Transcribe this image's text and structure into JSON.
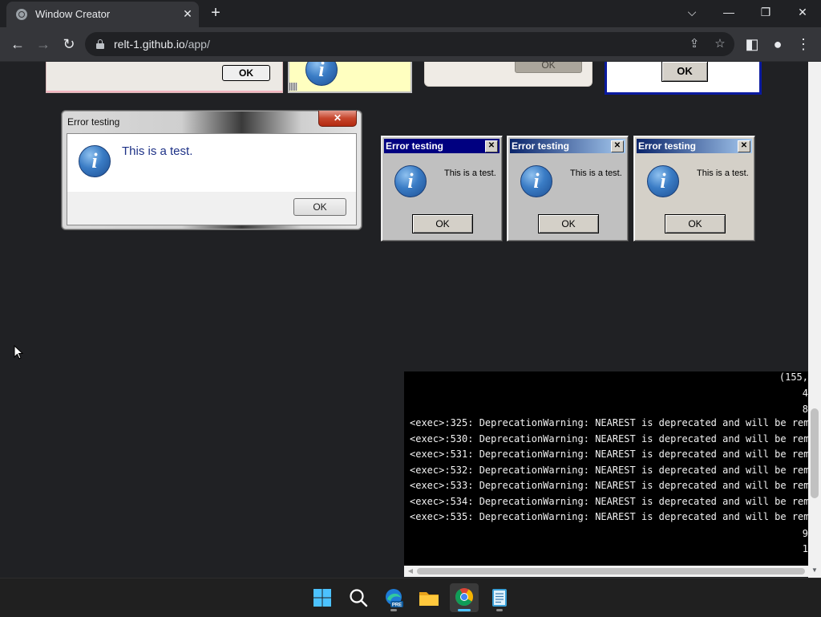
{
  "browser": {
    "tab_title": "Window Creator",
    "url_host": "relt-1.github.io",
    "url_path": "/app/"
  },
  "partial_dialogs": {
    "ok_1": "OK",
    "ok_3": "OK",
    "ok_4": "OK"
  },
  "win7_dialog": {
    "title": "Error testing",
    "message": "This is a test.",
    "ok_label": "OK"
  },
  "classic_dialogs": [
    {
      "title": "Error testing",
      "message": "This is a test.",
      "ok_label": "OK"
    },
    {
      "title": "Error testing",
      "message": "This is a test.",
      "ok_label": "OK"
    },
    {
      "title": "Error testing",
      "message": "This is a test.",
      "ok_label": "OK"
    }
  ],
  "console": {
    "top_right": [
      "(155,",
      "4",
      "8"
    ],
    "lines": [
      "<exec>:325: DeprecationWarning: NEAREST is deprecated and will be remo",
      "<exec>:530: DeprecationWarning: NEAREST is deprecated and will be remo",
      "<exec>:531: DeprecationWarning: NEAREST is deprecated and will be remo",
      "<exec>:532: DeprecationWarning: NEAREST is deprecated and will be remo",
      "<exec>:533: DeprecationWarning: NEAREST is deprecated and will be remo",
      "<exec>:534: DeprecationWarning: NEAREST is deprecated and will be remo",
      "<exec>:535: DeprecationWarning: NEAREST is deprecated and will be remo"
    ],
    "bottom_right": [
      "9",
      "1"
    ]
  },
  "taskbar": {
    "apps": [
      "start",
      "search",
      "edge-beta",
      "file-explorer",
      "chrome",
      "notepad"
    ],
    "edge_badge": "PRE",
    "active_app": "chrome"
  },
  "colors": {
    "chrome_dark": "#202124",
    "toolbar": "#35363a",
    "classic_title_blue": "#000080",
    "win7_close_red": "#c6452c",
    "taskbar_accent": "#4cc2ff"
  }
}
